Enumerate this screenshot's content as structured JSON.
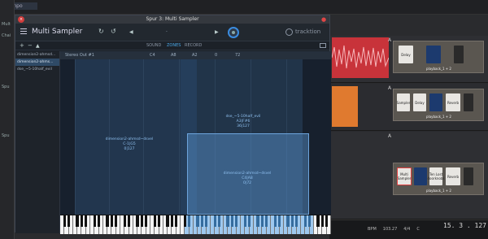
{
  "host": {
    "tempo_label": "Tempo",
    "side_labels": [
      "Mult",
      "Chai",
      "Spu",
      "Spu"
    ],
    "status": {
      "bpm_label": "BPM",
      "bpm": "103.27",
      "time_sig": "4/4",
      "key": "C",
      "timecode": "15. 3 . 127"
    },
    "tracks": [
      {
        "letter": "A",
        "plugins": [
          "Delay",
          "",
          ""
        ],
        "plugin_label": "playback_1 + 2"
      },
      {
        "letter": "A",
        "plugins": [
          "Sampler",
          "Delay",
          "",
          "Reverb"
        ],
        "plugin_label": "playback_1 + 2"
      },
      {
        "letter": "A",
        "plugins": [
          "Multi Sampler",
          "",
          "Ten Lost doorknobs",
          "Reverb"
        ],
        "plugin_label": "playback_1 + 2"
      }
    ],
    "colors": {
      "clip_red": "#c8333a",
      "clip_orange": "#e07a2f"
    }
  },
  "window": {
    "title": "Spur 3: Multi Sampler",
    "plugin_name": "Multi Sampler",
    "brand": "tracktion",
    "preset_value": "-",
    "toolbar_icons": [
      "menu-icon",
      "undo-icon",
      "redo-icon",
      "prev-icon",
      "next-icon"
    ],
    "subbar": {
      "add_label": "+",
      "remove_label": "−",
      "tabs": [
        {
          "label": "SOUND",
          "active": false
        },
        {
          "label": "ZONES",
          "active": true
        },
        {
          "label": "RECORD",
          "active": false
        }
      ]
    },
    "samples": [
      {
        "name": "dimension2-ahmsd...",
        "selected": false
      },
      {
        "name": "dimension2-ahms...",
        "selected": true
      },
      {
        "name": "dse_~5-10half_evil",
        "selected": false
      }
    ],
    "zone_header": {
      "output": "Stereo Out #1",
      "root": "C4",
      "low": "A8",
      "high": "A2",
      "vel_low": "0",
      "vel_high": "72"
    },
    "zones": [
      {
        "name": "dimension2-ahmsd~dsvel",
        "range": "C-1|G5",
        "vel": "0|127",
        "active": false
      },
      {
        "name": "dse_~5-10half_evil",
        "range": "A3|F#6",
        "vel": "36|127",
        "active": false
      },
      {
        "name": "dimension2-ahmsd~dsvel",
        "range": "C4|A8",
        "vel": "0|72",
        "active": true
      }
    ],
    "accent": "#4aa8e8"
  }
}
